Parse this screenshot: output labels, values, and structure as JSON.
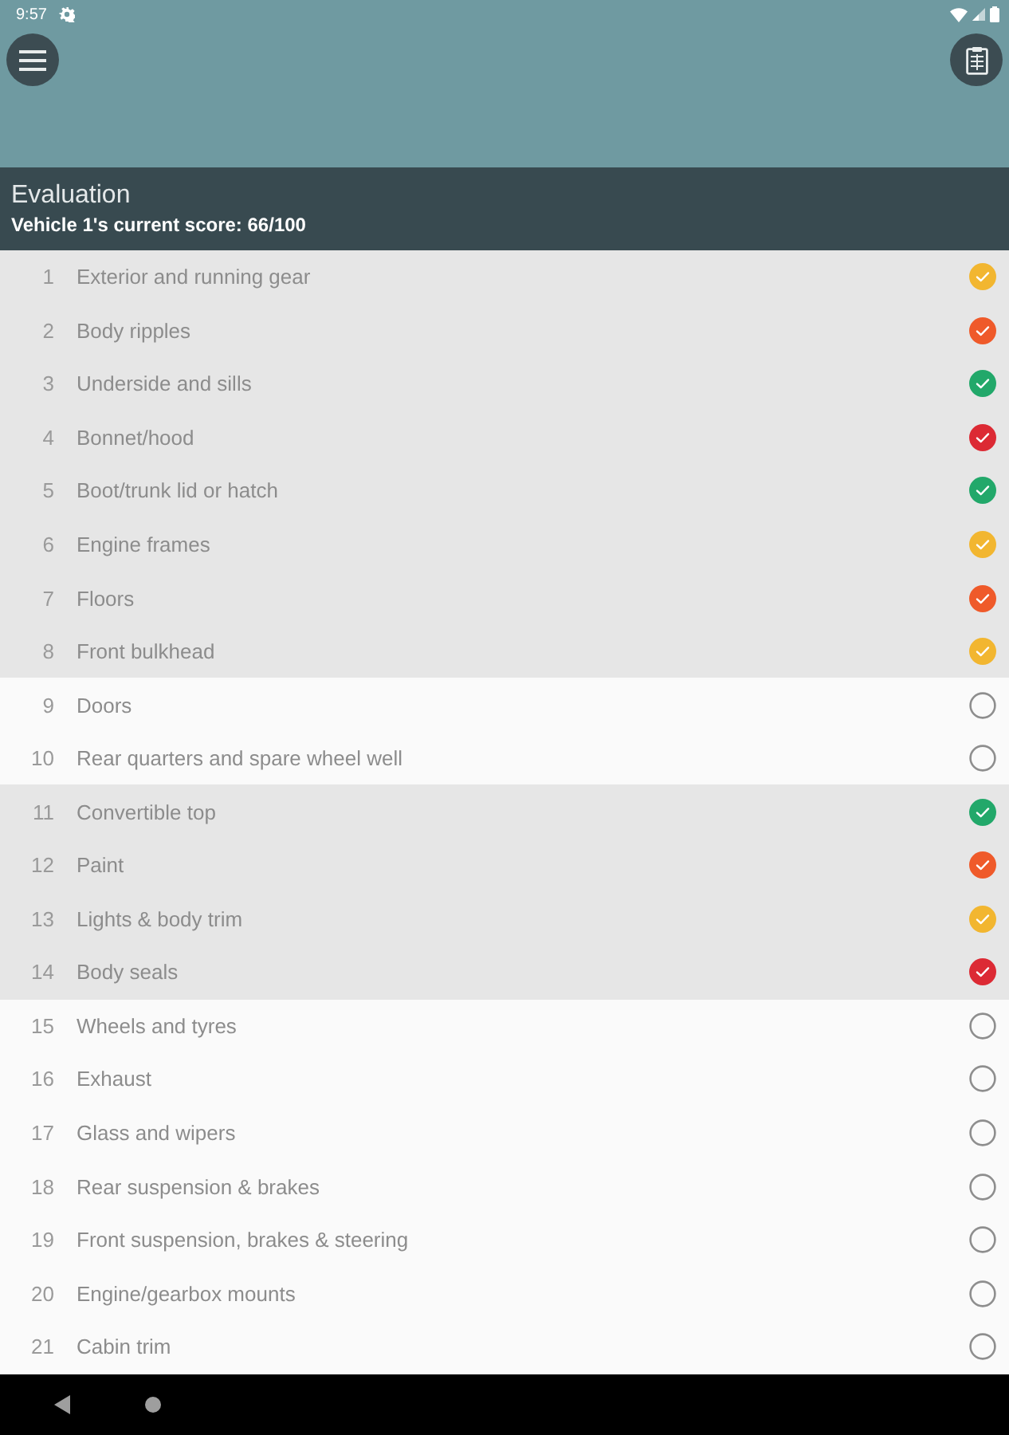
{
  "status_bar": {
    "time": "9:57"
  },
  "header": {
    "title": "Evaluation",
    "subtitle": "Vehicle 1's current score: 66/100"
  },
  "items": [
    {
      "number": "1",
      "label": "Exterior and running gear",
      "rated": true,
      "color": "#f2b630"
    },
    {
      "number": "2",
      "label": "Body ripples",
      "rated": true,
      "color": "#ef5a2a"
    },
    {
      "number": "3",
      "label": "Underside and sills",
      "rated": true,
      "color": "#22a86a"
    },
    {
      "number": "4",
      "label": "Bonnet/hood",
      "rated": true,
      "color": "#dc2a34"
    },
    {
      "number": "5",
      "label": "Boot/trunk lid or hatch",
      "rated": true,
      "color": "#22a86a"
    },
    {
      "number": "6",
      "label": "Engine frames",
      "rated": true,
      "color": "#f2b630"
    },
    {
      "number": "7",
      "label": "Floors",
      "rated": true,
      "color": "#ef5a2a"
    },
    {
      "number": "8",
      "label": "Front bulkhead",
      "rated": true,
      "color": "#f2b630"
    },
    {
      "number": "9",
      "label": "Doors",
      "rated": false
    },
    {
      "number": "10",
      "label": "Rear quarters and spare wheel well",
      "rated": false
    },
    {
      "number": "11",
      "label": "Convertible top",
      "rated": true,
      "color": "#22a86a"
    },
    {
      "number": "12",
      "label": "Paint",
      "rated": true,
      "color": "#ef5a2a"
    },
    {
      "number": "13",
      "label": "Lights & body trim",
      "rated": true,
      "color": "#f2b630"
    },
    {
      "number": "14",
      "label": "Body seals",
      "rated": true,
      "color": "#dc2a34"
    },
    {
      "number": "15",
      "label": "Wheels and tyres",
      "rated": false
    },
    {
      "number": "16",
      "label": "Exhaust",
      "rated": false
    },
    {
      "number": "17",
      "label": "Glass and wipers",
      "rated": false
    },
    {
      "number": "18",
      "label": "Rear suspension & brakes",
      "rated": false
    },
    {
      "number": "19",
      "label": "Front suspension, brakes & steering",
      "rated": false
    },
    {
      "number": "20",
      "label": "Engine/gearbox mounts",
      "rated": false
    },
    {
      "number": "21",
      "label": "Cabin trim",
      "rated": false
    }
  ]
}
